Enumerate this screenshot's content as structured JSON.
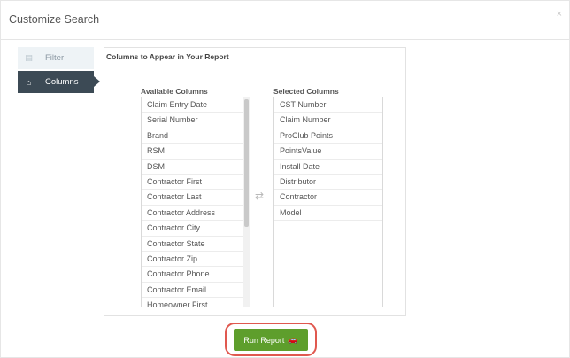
{
  "dialog": {
    "title": "Customize Search",
    "close_glyph": "×"
  },
  "tabs": [
    {
      "label": "Filter",
      "icon": "filter-icon",
      "glyph": "▤",
      "active": false
    },
    {
      "label": "Columns",
      "icon": "home-icon",
      "glyph": "⌂",
      "active": true
    }
  ],
  "panel": {
    "title": "Columns to Appear in Your Report",
    "available_header": "Available Columns",
    "selected_header": "Selected Columns",
    "swap_glyph": "⇄",
    "available": [
      "Claim Entry Date",
      "Serial Number",
      "Brand",
      "RSM",
      "DSM",
      "Contractor First",
      "Contractor Last",
      "Contractor Address",
      "Contractor City",
      "Contractor State",
      "Contractor Zip",
      "Contractor Phone",
      "Contractor Email",
      "Homeowner First"
    ],
    "selected": [
      "CST Number",
      "Claim Number",
      "ProClub Points",
      "PointsValue",
      "Install Date",
      "Distributor",
      "Contractor",
      "Model"
    ]
  },
  "run_button": {
    "label": "Run Report",
    "icon": "car-icon",
    "glyph": "🚗",
    "highlight_color": "#e0584f",
    "color": "#5e9e2c"
  }
}
